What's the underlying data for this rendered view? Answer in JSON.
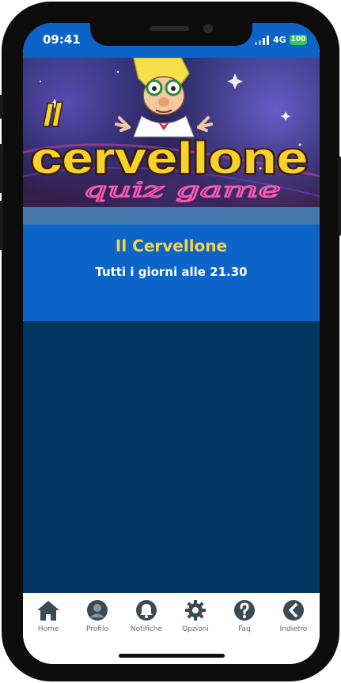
{
  "status_bar": {
    "time": "09:41",
    "network": "4G",
    "battery": "100"
  },
  "banner": {
    "logo_line1": "Il",
    "logo_line2": "cervellone",
    "logo_line3": "quiz game"
  },
  "show_info": {
    "title": "Il Cervellone",
    "schedule": "Tutti i giorni alle 21.30"
  },
  "tab_bar": {
    "items": [
      {
        "label": "Home",
        "icon": "home-icon"
      },
      {
        "label": "Profilo",
        "icon": "profile-icon"
      },
      {
        "label": "Notifiche",
        "icon": "bell-icon"
      },
      {
        "label": "Opzioni",
        "icon": "gear-icon"
      },
      {
        "label": "Faq",
        "icon": "question-icon"
      },
      {
        "label": "Indietro",
        "icon": "back-icon"
      }
    ]
  },
  "colors": {
    "status_bar": "#0d64c8",
    "info_box": "#0d64c8",
    "info_title": "#f2d64a",
    "content_bg": "#023562",
    "stripe": "#4577ad",
    "tab_icon": "#3b4a55"
  }
}
